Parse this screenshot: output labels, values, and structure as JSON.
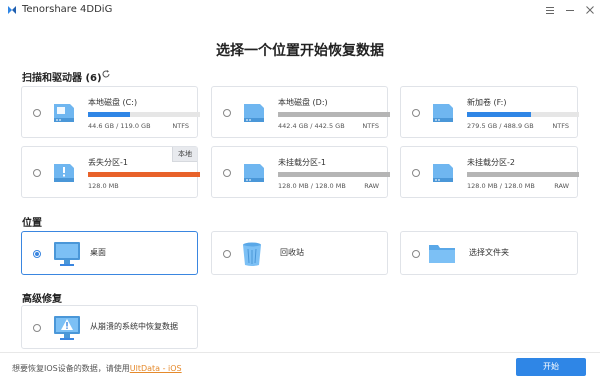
{
  "app": {
    "title": "Tenorshare 4DDiG"
  },
  "main_title": "选择一个位置开始恢复数据",
  "drives_section": {
    "label": "扫描和驱动器 (6)"
  },
  "drives": [
    {
      "name": "本地磁盘 (C:)",
      "size": "44.6 GB / 119.0 GB",
      "fs": "NTFS",
      "fill": 0.375,
      "color": "#2f86e6",
      "tag": ""
    },
    {
      "name": "本地磁盘 (D:)",
      "size": "442.4 GB / 442.5 GB",
      "fs": "NTFS",
      "fill": 1.0,
      "color": "#b5b5b5",
      "tag": ""
    },
    {
      "name": "新加卷 (F:)",
      "size": "279.5 GB / 488.9 GB",
      "fs": "NTFS",
      "fill": 0.572,
      "color": "#2f86e6",
      "tag": ""
    },
    {
      "name": "丢失分区-1",
      "size": "128.0 MB",
      "fs": "",
      "fill": 1.0,
      "color": "#e8622a",
      "tag": "本地"
    },
    {
      "name": "未挂载分区-1",
      "size": "128.0 MB / 128.0 MB",
      "fs": "RAW",
      "fill": 1.0,
      "color": "#b5b5b5",
      "tag": ""
    },
    {
      "name": "未挂载分区-2",
      "size": "128.0 MB / 128.0 MB",
      "fs": "RAW",
      "fill": 1.0,
      "color": "#b5b5b5",
      "tag": ""
    }
  ],
  "locations_section": {
    "label": "位置"
  },
  "locations": [
    {
      "label": "桌面",
      "selected": true
    },
    {
      "label": "回收站",
      "selected": false
    },
    {
      "label": "选择文件夹",
      "selected": false
    }
  ],
  "advanced_section": {
    "label": "高级修复"
  },
  "advanced": {
    "label": "从崩溃的系统中恢复数据"
  },
  "bottom": {
    "hint": "想要恢复IOS设备的数据，请使用",
    "hint_link": "UltData - iOS",
    "start_label": "开始"
  }
}
